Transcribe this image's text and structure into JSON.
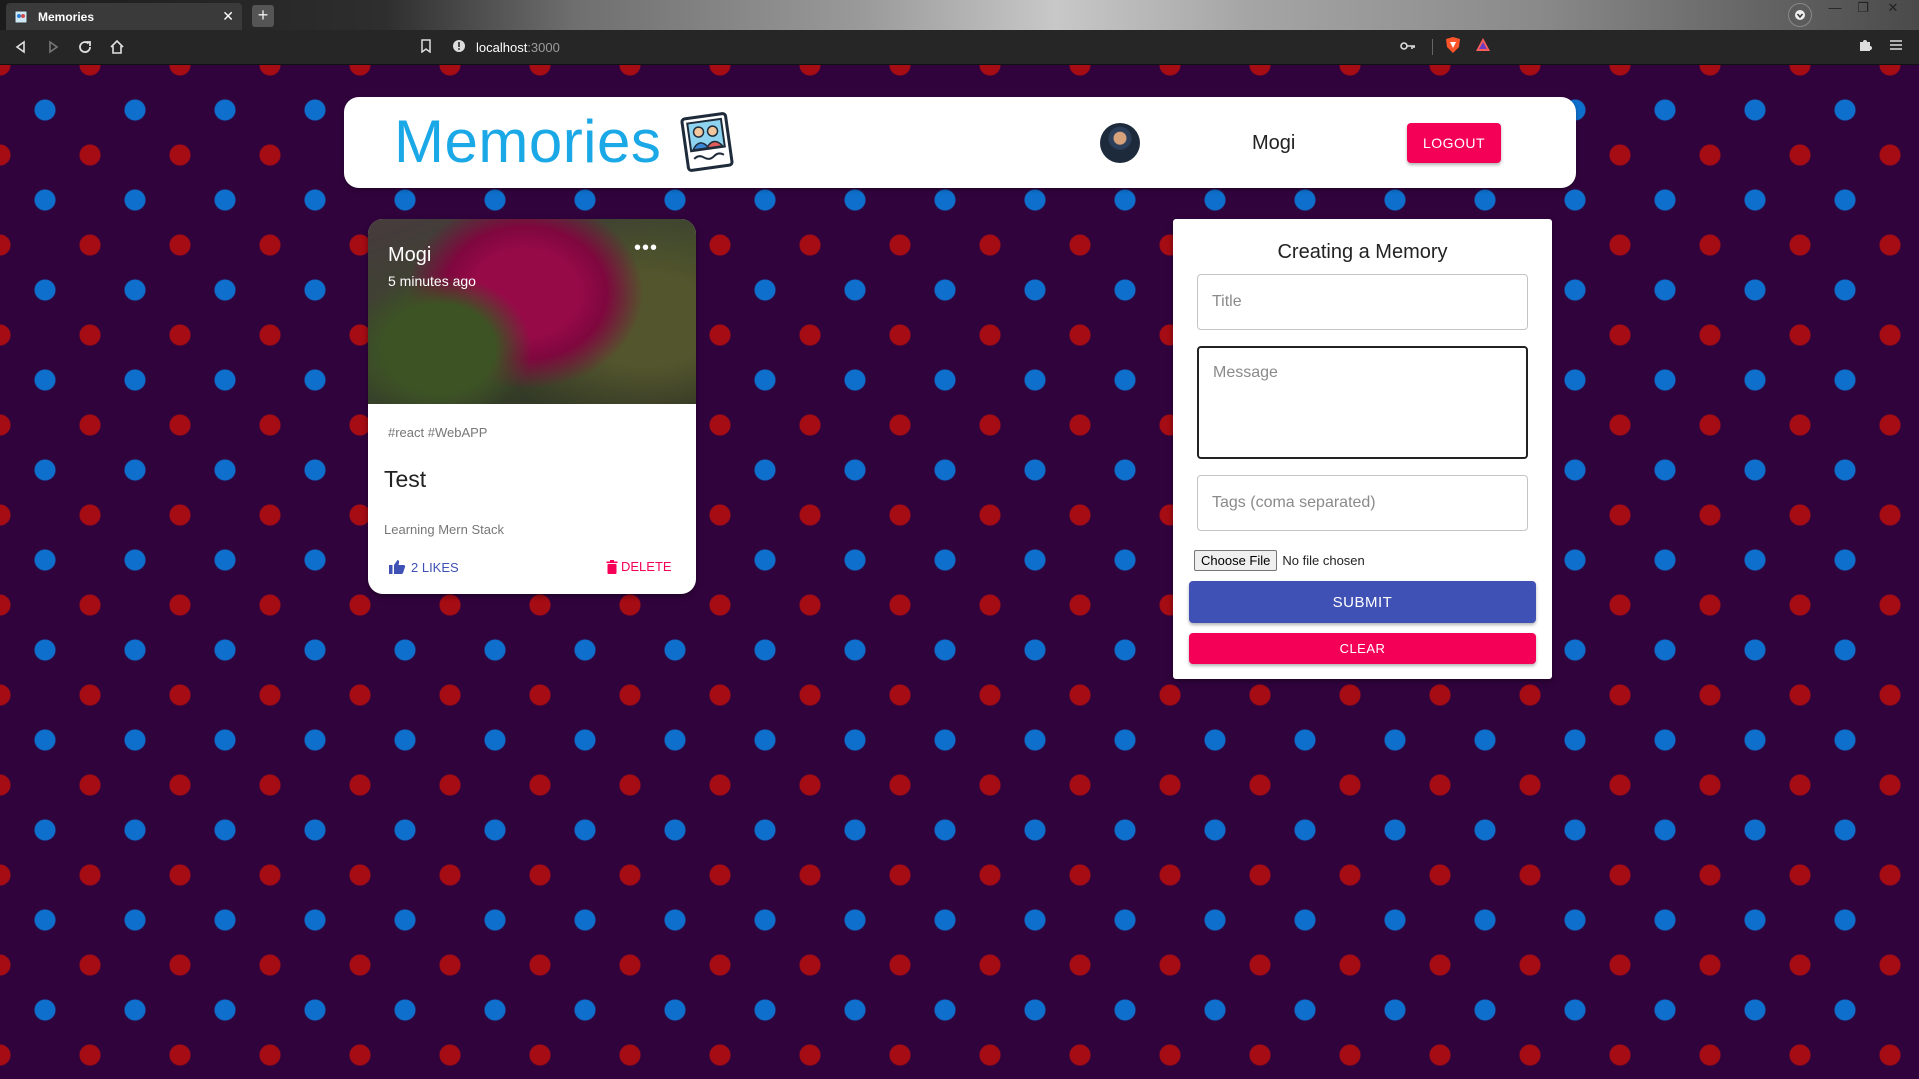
{
  "browser": {
    "tab_title": "Memories",
    "url_host": "localhost",
    "url_port": ":3000"
  },
  "header": {
    "brand": "Memories",
    "username": "Mogi",
    "logout_label": "LOGOUT"
  },
  "post": {
    "author": "Mogi",
    "time": "5 minutes ago",
    "tags": "#react #WebAPP",
    "title": "Test",
    "message": "Learning Mern Stack",
    "likes_label": "2 LIKES",
    "delete_label": "DELETE"
  },
  "form": {
    "heading": "Creating a Memory",
    "title_placeholder": "Title",
    "message_placeholder": "Message",
    "tags_placeholder": "Tags (coma separated)",
    "file_button": "Choose File",
    "file_status": "No file chosen",
    "submit_label": "SUBMIT",
    "clear_label": "CLEAR"
  },
  "colors": {
    "brand": "#1ba8e6",
    "primary": "#3f51b5",
    "secondary": "#f50057",
    "background": "#31033d",
    "dot_blue": "#0e70cc",
    "dot_red": "#a50c14"
  },
  "icons": [
    "memories-logo-icon",
    "thumb-up-icon",
    "delete-icon",
    "more-horiz-icon",
    "back-icon",
    "forward-icon",
    "reload-icon",
    "home-icon"
  ]
}
